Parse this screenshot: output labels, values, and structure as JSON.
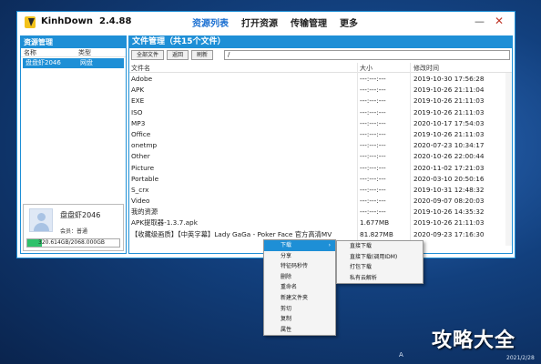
{
  "app": {
    "title": "KinhDown",
    "version": "2.4.88",
    "nav": [
      "资源列表",
      "打开资源",
      "传输管理",
      "更多"
    ],
    "minimize_glyph": "—",
    "close_glyph": "✕",
    "accent_color": "#1e8fd6"
  },
  "resources": {
    "header": "资源管理",
    "columns": [
      "名称",
      "类型"
    ],
    "rows": [
      {
        "name": "盘盘虾2046",
        "type": "网盘"
      }
    ]
  },
  "user": {
    "name": "盘盘虾2046",
    "level": "会员：普通",
    "quota": "320.614GB/2068.000GB",
    "quota_fraction": 0.155
  },
  "files": {
    "header": "文件管理（共15个文件）",
    "toolbar": [
      "全部文件",
      "返回",
      "刷新"
    ],
    "path": "/",
    "columns": [
      "文件名",
      "大小",
      "修改时间"
    ],
    "rows": [
      {
        "name": "Adobe",
        "size": "---:---:---",
        "time": "2019-10-30 17:56:28"
      },
      {
        "name": "APK",
        "size": "---:---:---",
        "time": "2019-10-26 21:11:04"
      },
      {
        "name": "EXE",
        "size": "---:---:---",
        "time": "2019-10-26 21:11:03"
      },
      {
        "name": "ISO",
        "size": "---:---:---",
        "time": "2019-10-26 21:11:03"
      },
      {
        "name": "MP3",
        "size": "---:---:---",
        "time": "2020-10-17 17:54:03"
      },
      {
        "name": "Office",
        "size": "---:---:---",
        "time": "2019-10-26 21:11:03"
      },
      {
        "name": "onetmp",
        "size": "---:---:---",
        "time": "2020-07-23 10:34:17"
      },
      {
        "name": "Other",
        "size": "---:---:---",
        "time": "2020-10-26 22:00:44"
      },
      {
        "name": "Picture",
        "size": "---:---:---",
        "time": "2020-11-02 17:21:03"
      },
      {
        "name": "Portable",
        "size": "---:---:---",
        "time": "2020-03-10 20:50:16"
      },
      {
        "name": "S_crx",
        "size": "---:---:---",
        "time": "2019-10-31 12:48:32"
      },
      {
        "name": "Video",
        "size": "---:---:---",
        "time": "2020-09-07 08:20:03"
      },
      {
        "name": "我的资源",
        "size": "---:---:---",
        "time": "2019-10-26 14:35:32"
      },
      {
        "name": "APK提取器-1.3.7.apk",
        "size": "1.677MB",
        "time": "2019-10-26 21:11:03"
      },
      {
        "name": "【收藏级画质】【中英字幕】Lady GaGa - Poker Face 官方高清MV",
        "size": "81.827MB",
        "time": "2020-09-23 17:16:30"
      }
    ]
  },
  "context_menu": {
    "items": [
      "下载",
      "分享",
      "特征码秒传",
      "删除",
      "重命名",
      "新建文件夹",
      "剪切",
      "复制",
      "属性"
    ],
    "submenu_arrow": "›",
    "submenu": [
      "直接下载",
      "直接下载(调用IDM)",
      "打包下载",
      "私有云解析"
    ]
  },
  "taskbar": {
    "ime": "A",
    "date": "2021/2/28"
  },
  "watermark": "攻略大全"
}
